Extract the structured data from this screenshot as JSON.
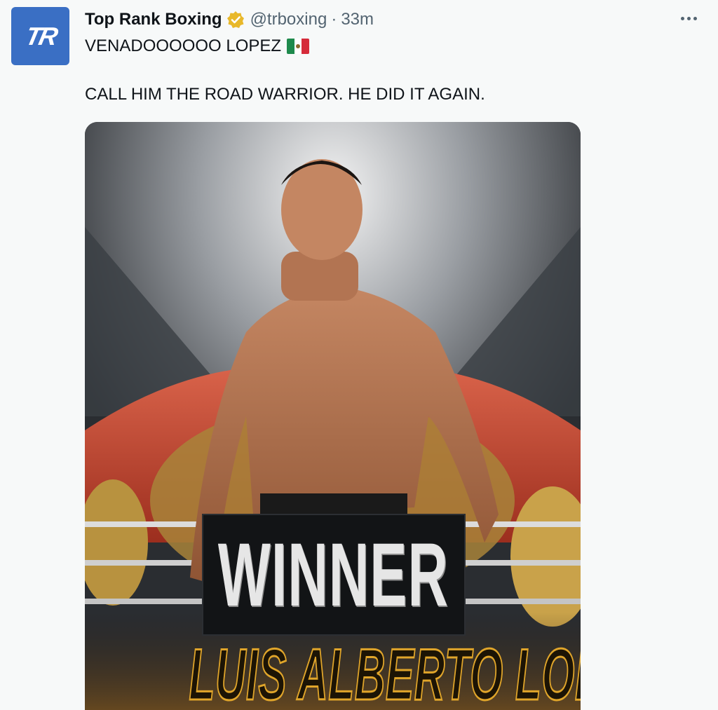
{
  "author": {
    "display_name": "Top Rank Boxing",
    "handle": "@trboxing",
    "separator": "·",
    "time_ago": "33m",
    "avatar_text": "TR",
    "verified_icon": "gold-verified-badge-icon"
  },
  "tweet": {
    "line1": "VENADOOOOOO LOPEZ",
    "line1_emoji": "mexico-flag-icon",
    "line2": "CALL HIM THE ROAD WARRIOR. HE DID IT AGAIN."
  },
  "media": {
    "headline": "WINNER",
    "fighter_name": "LUIS ALBERTO LOPEZ"
  },
  "menu": {
    "icon": "more-options-icon"
  },
  "colors": {
    "avatar_bg": "#3a6fc4",
    "verified": "#e8b82a",
    "secondary_text": "#536471",
    "name_gold": "#e0a52a"
  }
}
